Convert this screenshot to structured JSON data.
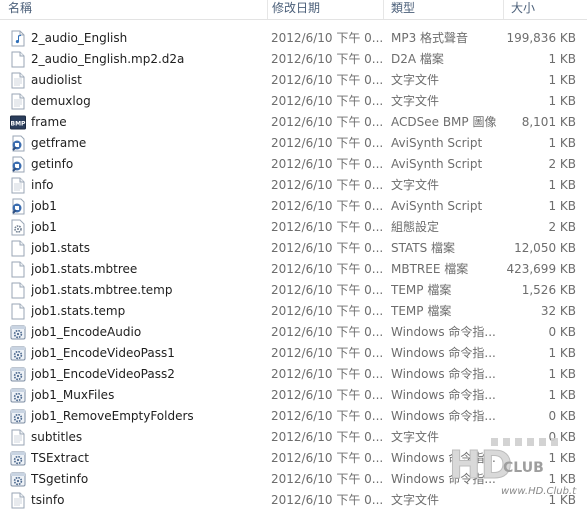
{
  "header": {
    "name": "名稱",
    "date": "修改日期",
    "type": "類型",
    "size": "大小"
  },
  "files": [
    {
      "name": "2_audio_English",
      "date": "2012/6/10 下午 0...",
      "type": "MP3 格式聲音",
      "size": "199,836 KB",
      "icon": "music-file-icon"
    },
    {
      "name": "2_audio_English.mp2.d2a",
      "date": "2012/6/10 下午 0...",
      "type": "D2A 檔案",
      "size": "1 KB",
      "icon": "document-file-icon"
    },
    {
      "name": "audiolist",
      "date": "2012/6/10 下午 0...",
      "type": "文字文件",
      "size": "1 KB",
      "icon": "text-file-icon"
    },
    {
      "name": "demuxlog",
      "date": "2012/6/10 下午 0...",
      "type": "文字文件",
      "size": "1 KB",
      "icon": "text-file-icon"
    },
    {
      "name": "frame",
      "date": "2012/6/10 下午 0...",
      "type": "ACDSee BMP 圖像",
      "size": "8,101 KB",
      "icon": "bmp-image-icon"
    },
    {
      "name": "getframe",
      "date": "2012/6/10 下午 0...",
      "type": "AviSynth Script",
      "size": "1 KB",
      "icon": "avisynth-script-icon"
    },
    {
      "name": "getinfo",
      "date": "2012/6/10 下午 0...",
      "type": "AviSynth Script",
      "size": "2 KB",
      "icon": "avisynth-script-icon"
    },
    {
      "name": "info",
      "date": "2012/6/10 下午 0...",
      "type": "文字文件",
      "size": "1 KB",
      "icon": "text-file-icon"
    },
    {
      "name": "job1",
      "date": "2012/6/10 下午 0...",
      "type": "AviSynth Script",
      "size": "1 KB",
      "icon": "avisynth-script-icon"
    },
    {
      "name": "job1",
      "date": "2012/6/10 下午 0...",
      "type": "組態設定",
      "size": "2 KB",
      "icon": "config-file-icon"
    },
    {
      "name": "job1.stats",
      "date": "2012/6/10 下午 0...",
      "type": "STATS 檔案",
      "size": "12,050 KB",
      "icon": "document-file-icon"
    },
    {
      "name": "job1.stats.mbtree",
      "date": "2012/6/10 下午 0...",
      "type": "MBTREE 檔案",
      "size": "423,699 KB",
      "icon": "document-file-icon"
    },
    {
      "name": "job1.stats.mbtree.temp",
      "date": "2012/6/10 下午 0...",
      "type": "TEMP 檔案",
      "size": "1,526 KB",
      "icon": "document-file-icon"
    },
    {
      "name": "job1.stats.temp",
      "date": "2012/6/10 下午 0...",
      "type": "TEMP 檔案",
      "size": "32 KB",
      "icon": "document-file-icon"
    },
    {
      "name": "job1_EncodeAudio",
      "date": "2012/6/10 下午 0...",
      "type": "Windows 命令指...",
      "size": "0 KB",
      "icon": "batch-file-icon"
    },
    {
      "name": "job1_EncodeVideoPass1",
      "date": "2012/6/10 下午 0...",
      "type": "Windows 命令指...",
      "size": "1 KB",
      "icon": "batch-file-icon"
    },
    {
      "name": "job1_EncodeVideoPass2",
      "date": "2012/6/10 下午 0...",
      "type": "Windows 命令指...",
      "size": "1 KB",
      "icon": "batch-file-icon"
    },
    {
      "name": "job1_MuxFiles",
      "date": "2012/6/10 下午 0...",
      "type": "Windows 命令指...",
      "size": "1 KB",
      "icon": "batch-file-icon"
    },
    {
      "name": "job1_RemoveEmptyFolders",
      "date": "2012/6/10 下午 0...",
      "type": "Windows 命令指...",
      "size": "0 KB",
      "icon": "batch-file-icon"
    },
    {
      "name": "subtitles",
      "date": "2012/6/10 下午 0...",
      "type": "文字文件",
      "size": "0 KB",
      "icon": "text-file-icon"
    },
    {
      "name": "TSExtract",
      "date": "2012/6/10 下午 0...",
      "type": "Windows 命令指...",
      "size": "1 KB",
      "icon": "batch-file-icon"
    },
    {
      "name": "TSgetinfo",
      "date": "2012/6/10 下午 0...",
      "type": "Windows 命令指...",
      "size": "1 KB",
      "icon": "batch-file-icon"
    },
    {
      "name": "tsinfo",
      "date": "2012/6/10 下午 0...",
      "type": "文字文件",
      "size": "1 KB",
      "icon": "text-file-icon"
    }
  ],
  "watermark": {
    "logo": "HD",
    "club": "CLUB",
    "url": "www.HD.Club.tw",
    "icon": "hdclub-watermark-logo"
  }
}
